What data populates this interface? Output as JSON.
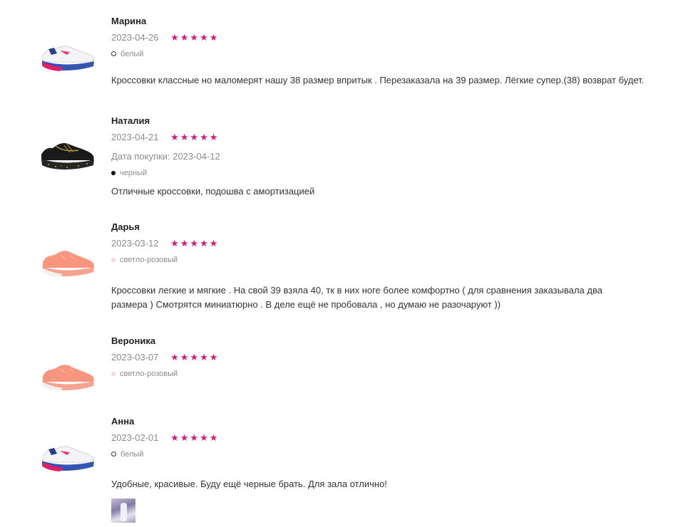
{
  "reviews": [
    {
      "author": "Марина",
      "date": "2023-04-26",
      "rating": 5,
      "stars": "★★★★★",
      "purchase_date": "",
      "color_name": "белый",
      "color_dot": "#ffffff",
      "text": "Кроссовки классные но маломерят нашу 38 размер впритык . Перезаказала на 39 размер. Лёгкие супер.(38) возврат будет.",
      "thumbnail": "sneaker-white-pink-blue-icon"
    },
    {
      "author": "Наталия",
      "date": "2023-04-21",
      "rating": 5,
      "stars": "★★★★★",
      "purchase_date": "Дата покупки: 2023-04-12",
      "color_name": "черный",
      "color_dot": "#000000",
      "text": "Отличные кроссовки, подошва с амортизацией",
      "thumbnail": "sneaker-black-gold-icon"
    },
    {
      "author": "Дарья",
      "date": "2023-03-12",
      "rating": 5,
      "stars": "★★★★★",
      "purchase_date": "",
      "color_name": "светло-розовый",
      "color_dot": "#fcd6e0",
      "text": "Кроссовки легкие и мягкие . На свой 39 взяла 40, тк в них ноге более комфортно ( для сравнения заказывала два размера ) Смотрятся миниатюрно . В деле ещё не пробовала , но думаю не разочаруют ))",
      "thumbnail": "sneaker-coral-icon"
    },
    {
      "author": "Вероника",
      "date": "2023-03-07",
      "rating": 5,
      "stars": "★★★★★",
      "purchase_date": "",
      "color_name": "светло-розовый",
      "color_dot": "#fcd6e0",
      "text": "",
      "thumbnail": "sneaker-coral-icon"
    },
    {
      "author": "Анна",
      "date": "2023-02-01",
      "rating": 5,
      "stars": "★★★★★",
      "purchase_date": "",
      "color_name": "белый",
      "color_dot": "#ffffff",
      "text": "Удобные, красивые. Буду ещё черные брать. Для зала отлично!",
      "thumbnail": "sneaker-white-pink-blue-icon",
      "photo": "review-photo"
    }
  ],
  "colors": {
    "star": "#d6197b",
    "muted": "#8c8c8c",
    "text": "#333333"
  }
}
